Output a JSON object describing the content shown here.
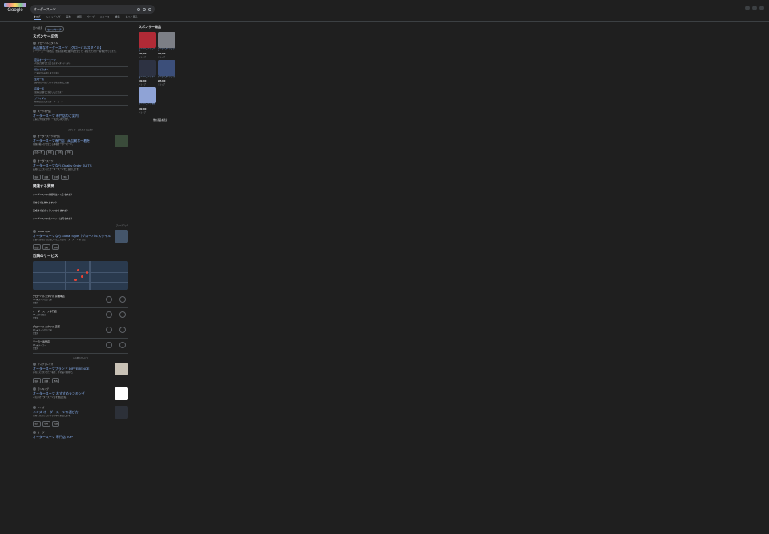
{
  "header": {
    "logo_text": "Google",
    "query": "オーダースーツ",
    "tabs": [
      {
        "label": "すべて",
        "active": true
      },
      {
        "label": "ショッピング"
      },
      {
        "label": "画像"
      },
      {
        "label": "地図"
      },
      {
        "label": "ウェブ"
      },
      {
        "label": "ニュース"
      },
      {
        "label": "書籍"
      },
      {
        "label": "もっと見る"
      }
    ]
  },
  "filters": {
    "label": "並べ替え",
    "chip": "セーフサーチ"
  },
  "main": {
    "sponsored_heading": "スポンサー広告",
    "ad1": {
      "site": "グローバルスタイル",
      "title": "高品質なオーダースーツ【グローバルスタイル】",
      "snippet": "オーダースーツ専門店。豊富な生地と確かな仕立てで、あなただけの一着をお作りします。",
      "sitelinks": [
        {
          "t": "定番オーダースーツ",
          "d": "人気の生地で仕立てるスタンダードモデル"
        },
        {
          "t": "初めての方へ",
          "d": "ご来店からお渡しまでの流れ"
        },
        {
          "t": "生地一覧",
          "d": "国内外の人気ブランド生地を多数ご用意"
        },
        {
          "t": "店舗一覧",
          "d": "全国の店舗でご採寸いただけます"
        },
        {
          "t": "ブライダル",
          "d": "特別な日のためのオーダースーツ"
        }
      ]
    },
    "ad2": {
      "site": "スーツ専門店",
      "title": "オーダースーツ 専門店のご案内",
      "snippet": "ご来店予約受付中。一着から承ります。"
    },
    "ad_divider": "スポンサー広告をさらに表示",
    "res1": {
      "site": "オーダースーツ専門店",
      "title": "オーダースーツ専門店 - 高品質な一着を",
      "snippet": "熟練の職人が仕立てる本格オーダースーツ。",
      "chips": [
        "店舗一覧",
        "料金",
        "生地",
        "予約"
      ]
    },
    "res2": {
      "site": "オーダースーツ",
      "title": "オーダースーツなら Quality Order SUITS",
      "snippet": "品質にこだわったオーダースーツをご提供します。",
      "chips": [
        "価格",
        "店舗",
        "生地",
        "予約"
      ]
    },
    "paa_heading": "関連する質問",
    "paa": [
      "オーダースーツの相場はいくらですか？",
      "初めてでも作れますか？",
      "完成までどのくらいかかりますか？",
      "オーダースーツのメリットは何ですか？"
    ],
    "feedback": "フィードバック",
    "res3": {
      "site": "Global Style",
      "title": "オーダースーツならGlobal Style（グローバルスタイル）",
      "snippet": "豊富な生地からお選びいただけるオーダースーツ専門店。",
      "chips": [
        "店舗",
        "生地",
        "予約"
      ]
    },
    "places_heading": "近隣のサービス",
    "locations": [
      {
        "name": "グローバルスタイル 京橋本店",
        "info": "5.0 ★ スーツ仕立て屋",
        "hours": "営業中"
      },
      {
        "name": "オーダースーツ専門店",
        "info": "4.5 ★ 紳士服店",
        "hours": "営業中"
      },
      {
        "name": "グローバルスタイル 店舗",
        "info": "4.3 ★ スーツ仕立て屋",
        "hours": "営業中"
      },
      {
        "name": "テーラー専門店",
        "info": "4.6 ★ テーラー",
        "hours": "営業中"
      }
    ],
    "places_more": "その他のサービス",
    "res4": {
      "site": "ディファレンス",
      "title": "オーダースーツブランド DIFFERENCE",
      "snippet": "あなたに合わせた一着を、手の届く価格で。",
      "chips": [
        "価格",
        "店舗",
        "予約"
      ]
    },
    "res5": {
      "site": "ランキング",
      "title": "オーダースーツ おすすめランキング",
      "snippet": "人気のオーダースーツ店を徹底比較。"
    },
    "res6": {
      "site": "メンズ",
      "title": "メンズ オーダースーツの選び方",
      "snippet": "初めての方にもわかりやすく解説します。",
      "chips": [
        "価格",
        "生地",
        "店舗"
      ]
    },
    "res7": {
      "site": "オーダー",
      "title": "オーダースーツ 専門店 TOP"
    }
  },
  "side": {
    "heading": "スポンサー商品",
    "products": [
      {
        "title": "オーダースーツ ウール",
        "price": "¥39,000",
        "store": "ショップ",
        "color": "#b02a36"
      },
      {
        "title": "オーダースーツ グレー",
        "price": "¥29,000",
        "store": "ショップ",
        "color": "#7c7f86"
      },
      {
        "title": "オーダースーツ ネイビー",
        "price": "¥39,000",
        "store": "ショップ",
        "color": "#2d3242"
      },
      {
        "title": "オーダースーツ ブルー",
        "price": "¥35,000",
        "store": "ショップ",
        "color": "#3c4f7a"
      },
      {
        "title": "オーダースーツ 春夏",
        "price": "¥32,000",
        "store": "ショップ",
        "color": "#8fa3d6"
      }
    ],
    "more": "他の商品を表示"
  }
}
